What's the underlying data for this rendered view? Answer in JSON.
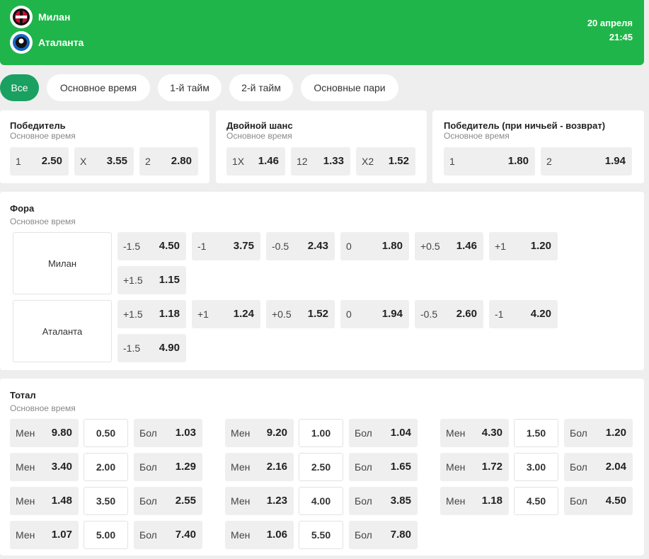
{
  "header": {
    "home_team": "Милан",
    "away_team": "Аталанта",
    "date": "20 апреля",
    "time": "21:45"
  },
  "tabs": [
    "Все",
    "Основное время",
    "1-й тайм",
    "2-й тайм",
    "Основные пари"
  ],
  "markets": {
    "winner": {
      "title": "Победитель",
      "sub": "Основное время",
      "odds": [
        [
          "1",
          "2.50"
        ],
        [
          "X",
          "3.55"
        ],
        [
          "2",
          "2.80"
        ]
      ]
    },
    "double": {
      "title": "Двойной шанс",
      "sub": "Основное время",
      "odds": [
        [
          "1X",
          "1.46"
        ],
        [
          "12",
          "1.33"
        ],
        [
          "X2",
          "1.52"
        ]
      ]
    },
    "dnb": {
      "title": "Победитель (при ничьей - возврат)",
      "sub": "Основное время",
      "odds": [
        [
          "1",
          "1.80"
        ],
        [
          "2",
          "1.94"
        ]
      ]
    }
  },
  "handicap": {
    "title": "Фора",
    "sub": "Основное время",
    "rows": [
      {
        "team": "Милан",
        "odds": [
          [
            "-1.5",
            "4.50"
          ],
          [
            "-1",
            "3.75"
          ],
          [
            "-0.5",
            "2.43"
          ],
          [
            "0",
            "1.80"
          ],
          [
            "+0.5",
            "1.46"
          ],
          [
            "+1",
            "1.20"
          ],
          [
            "+1.5",
            "1.15"
          ]
        ]
      },
      {
        "team": "Аталанта",
        "odds": [
          [
            "+1.5",
            "1.18"
          ],
          [
            "+1",
            "1.24"
          ],
          [
            "+0.5",
            "1.52"
          ],
          [
            "0",
            "1.94"
          ],
          [
            "-0.5",
            "2.60"
          ],
          [
            "-1",
            "4.20"
          ],
          [
            "-1.5",
            "4.90"
          ]
        ]
      }
    ]
  },
  "total": {
    "title": "Тотал",
    "sub": "Основное время",
    "under": "Мен",
    "over": "Бол",
    "columns": [
      [
        [
          "9.80",
          "0.50",
          "1.03"
        ],
        [
          "3.40",
          "2.00",
          "1.29"
        ],
        [
          "1.48",
          "3.50",
          "2.55"
        ],
        [
          "1.07",
          "5.00",
          "7.40"
        ]
      ],
      [
        [
          "9.20",
          "1.00",
          "1.04"
        ],
        [
          "2.16",
          "2.50",
          "1.65"
        ],
        [
          "1.23",
          "4.00",
          "3.85"
        ],
        [
          "1.06",
          "5.50",
          "7.80"
        ]
      ],
      [
        [
          "4.30",
          "1.50",
          "1.20"
        ],
        [
          "1.72",
          "3.00",
          "2.04"
        ],
        [
          "1.18",
          "4.50",
          "4.50"
        ]
      ]
    ]
  }
}
